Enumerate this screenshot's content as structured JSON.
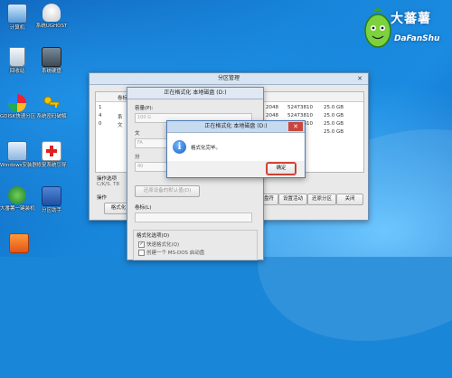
{
  "desktop": {
    "icons": [
      {
        "label": "计算机"
      },
      {
        "label": "系统UGHOST"
      },
      {
        "label": "回收站"
      },
      {
        "label": "系统硬盘"
      },
      {
        "label": "GDISK快速分区"
      },
      {
        "label": "系统密码破解"
      },
      {
        "label": "Windows安装器"
      },
      {
        "label": "修复系统引导"
      },
      {
        "label": "大番薯一键装机"
      },
      {
        "label": "分区助手"
      },
      {
        "label": ""
      }
    ],
    "logo": {
      "brand": "大蕃薯",
      "brand_en": "DaFanShu"
    }
  },
  "partition_window": {
    "title": "分区管理",
    "close_glyph": "✕",
    "headers": [
      "卷标",
      "",
      "",
      "",
      "",
      "",
      "",
      "",
      ""
    ],
    "rows": [
      {
        "idx": "1",
        "name": "",
        "c1": "2048",
        "c2": "52473810",
        "c3": "25.0 GB"
      },
      {
        "idx": "4",
        "name": "系",
        "c1": "2048",
        "c2": "52473810",
        "c3": "25.0 GB"
      },
      {
        "idx": "0",
        "name": "文",
        "c1": "2048",
        "c2": "52473810",
        "c3": "25.0 GB"
      },
      {
        "idx": "",
        "name": "",
        "c1": "",
        "c2": "",
        "c3": "25.0 GB"
      }
    ],
    "info_label": "操作选项",
    "info_text": "C/K/S. T8",
    "ops_label": "操作",
    "button_format": "格式化",
    "button_mkdir": "建",
    "button_assign": "分配盘符",
    "button_activate": "设置活动",
    "button_restore": "还原分区",
    "button_close": "关闭"
  },
  "format_window": {
    "title": "正在格式化 本地磁盘 (D:)",
    "capacity_label": "容量(P):",
    "capacity_value": "100 G",
    "fs_label": "文",
    "fs_value": "FA",
    "alloc_label": "分",
    "alloc_value": "40",
    "restore_defaults": "还原设备的默认值(D)",
    "volume_label": "卷标(L)",
    "format_options": "格式化选项(O)",
    "quick_format": "快速格式化(Q)",
    "msdos_disk": "创建一个 MS-DOS 启动盘"
  },
  "dialog": {
    "title": "正在格式化 本地磁盘 (D:)",
    "message": "格式化完毕。",
    "ok_label": "确定",
    "close_glyph": "✕"
  }
}
